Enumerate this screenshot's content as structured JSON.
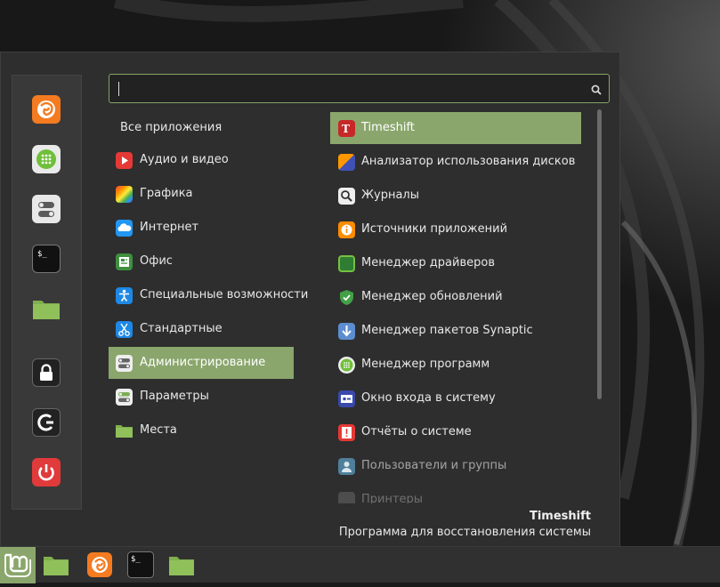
{
  "search": {
    "value": "",
    "placeholder": ""
  },
  "favorites": [
    {
      "icon": "firefox-icon"
    },
    {
      "icon": "software-manager-icon"
    },
    {
      "icon": "system-settings-icon"
    },
    {
      "icon": "terminal-icon"
    },
    {
      "icon": "files-folder-icon"
    },
    {
      "icon": "lock-screen-icon"
    },
    {
      "icon": "logout-icon"
    },
    {
      "icon": "shutdown-icon"
    }
  ],
  "categories": [
    {
      "label": "Все приложения"
    },
    {
      "label": "Аудио и видео",
      "icon": "audio-video-icon"
    },
    {
      "label": "Графика",
      "icon": "graphics-icon"
    },
    {
      "label": "Интернет",
      "icon": "internet-icon"
    },
    {
      "label": "Офис",
      "icon": "office-icon"
    },
    {
      "label": "Специальные возможности",
      "icon": "accessibility-icon"
    },
    {
      "label": "Стандартные",
      "icon": "accessories-icon"
    },
    {
      "label": "Администрирование",
      "icon": "administration-icon",
      "selected": true
    },
    {
      "label": "Параметры",
      "icon": "preferences-icon"
    },
    {
      "label": "Места",
      "icon": "places-folder-icon"
    }
  ],
  "apps": [
    {
      "label": "Timeshift",
      "icon": "timeshift-icon",
      "selected": true
    },
    {
      "label": "Анализатор использования дисков",
      "icon": "disk-usage-icon"
    },
    {
      "label": "Журналы",
      "icon": "logs-icon"
    },
    {
      "label": "Источники приложений",
      "icon": "software-sources-icon"
    },
    {
      "label": "Менеджер драйверов",
      "icon": "driver-manager-icon"
    },
    {
      "label": "Менеджер обновлений",
      "icon": "update-manager-icon"
    },
    {
      "label": "Менеджер пакетов Synaptic",
      "icon": "synaptic-icon"
    },
    {
      "label": "Менеджер программ",
      "icon": "software-manager-icon"
    },
    {
      "label": "Окно входа в систему",
      "icon": "login-window-icon"
    },
    {
      "label": "Отчёты о системе",
      "icon": "system-reports-icon"
    },
    {
      "label": "Пользователи и группы",
      "icon": "users-groups-icon"
    },
    {
      "label": "Принтеры",
      "icon": "printers-icon"
    }
  ],
  "description": {
    "title": "Timeshift",
    "text": "Программа для восстановления системы"
  },
  "panel": {
    "items": [
      {
        "icon": "mint-menu-icon"
      },
      {
        "icon": "files-folder-icon"
      },
      {
        "icon": "firefox-icon"
      },
      {
        "icon": "terminal-icon"
      },
      {
        "icon": "files-folder-icon"
      }
    ]
  },
  "colors": {
    "accent": "#8aa66c",
    "menu_bg": "#2e2e2e",
    "panel_bg": "#303030"
  }
}
